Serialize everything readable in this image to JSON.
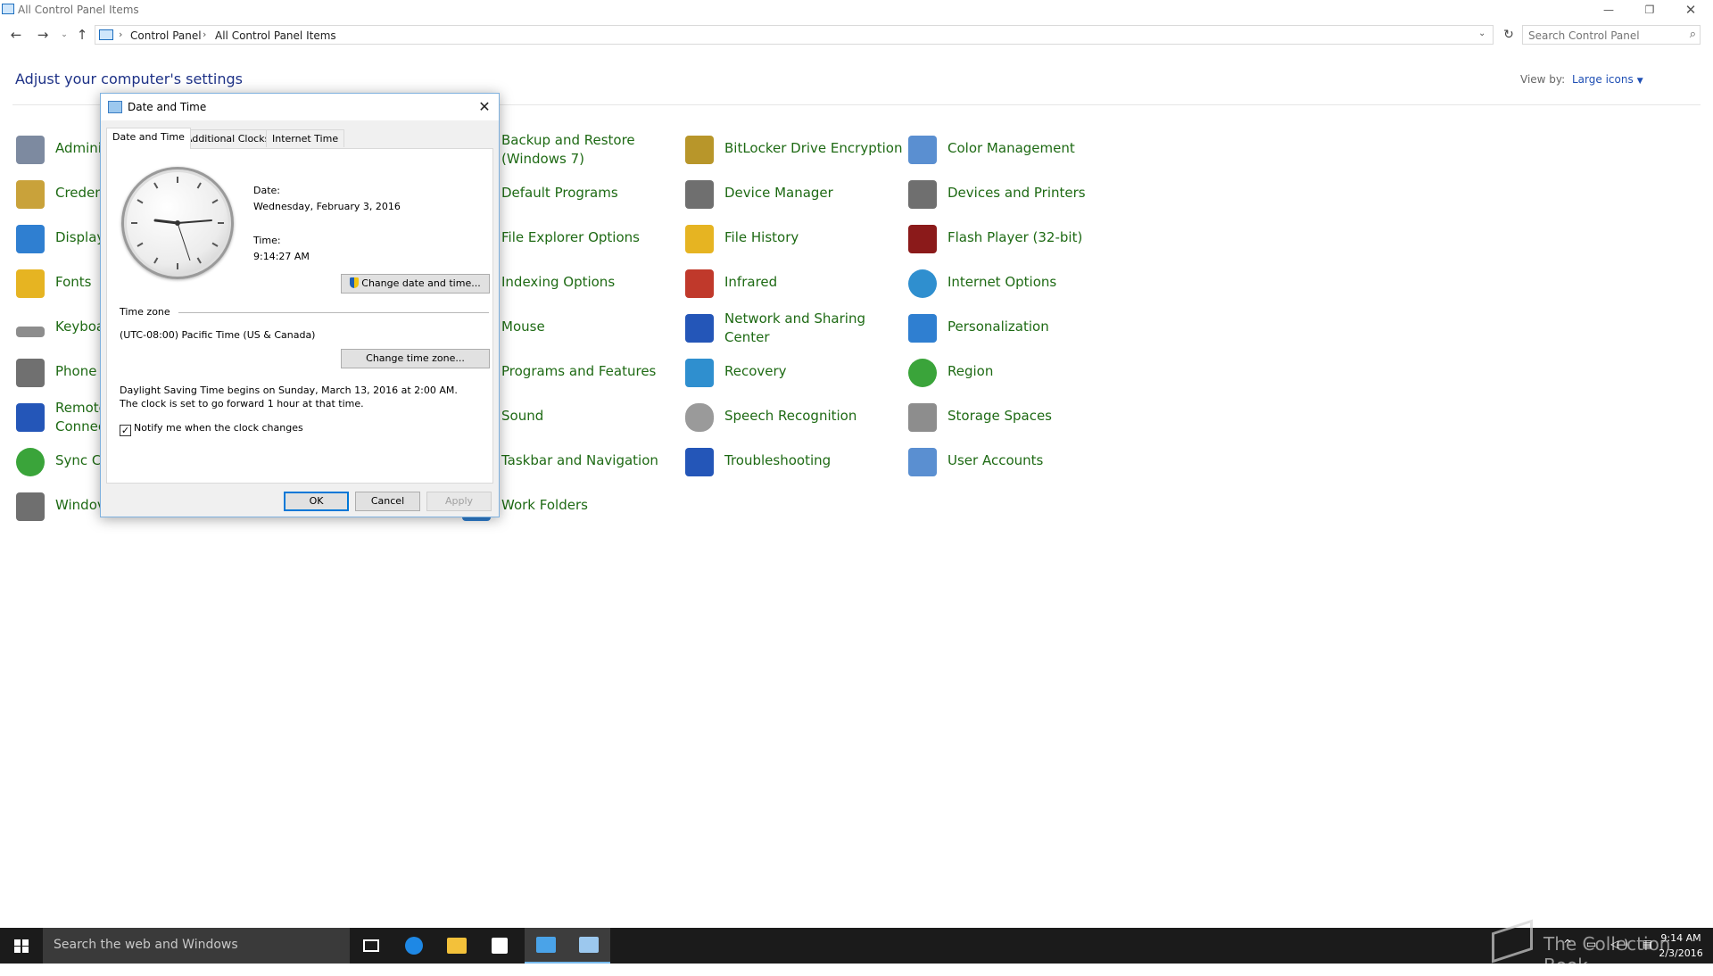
{
  "window": {
    "title": "All Control Panel Items",
    "minimize": "—",
    "maximize": "❐",
    "close": "✕"
  },
  "address": {
    "back": "←",
    "forward": "→",
    "recent": "⌄",
    "up": "↑",
    "separator": "›",
    "crumbs": [
      "Control Panel",
      "All Control Panel Items"
    ],
    "dropdown": "⌄",
    "refresh": "↻",
    "search_placeholder": "Search Control Panel",
    "search_icon": "⌕"
  },
  "header": {
    "title": "Adjust your computer's settings",
    "view_by_label": "View by:",
    "view_by_value": "Large icons",
    "view_by_caret": "▼"
  },
  "items": [
    {
      "label": "Admini",
      "icon": "administrative-tools-icon",
      "color": "#7d8aa0"
    },
    {
      "label": "Creden",
      "icon": "credential-manager-icon",
      "color": "#c9a23a"
    },
    {
      "label": "Display",
      "icon": "display-icon",
      "color": "#2f7fd1"
    },
    {
      "label": "Fonts",
      "icon": "fonts-icon",
      "color": "#e6b422"
    },
    {
      "label": "Keyboa",
      "icon": "keyboard-icon",
      "color": "#8d8d8d"
    },
    {
      "label": "Phone",
      "icon": "phone-icon",
      "color": "#707070"
    },
    {
      "label": "Remote\nConnec",
      "icon": "remote-app-icon",
      "color": "#2456b8"
    },
    {
      "label": "Sync C",
      "icon": "sync-center-icon",
      "color": "#3aa43a"
    },
    {
      "label": "Windov",
      "icon": "windows-firewall-icon",
      "color": "#6f6f6f"
    },
    {
      "label": "Backup and Restore (Windows 7)",
      "icon": "backup-restore-icon",
      "color": "#3f8f3f"
    },
    {
      "label": "Default Programs",
      "icon": "default-programs-icon",
      "color": "#2f7fd1"
    },
    {
      "label": "File Explorer Options",
      "icon": "file-explorer-options-icon",
      "color": "#e6b422"
    },
    {
      "label": "Indexing Options",
      "icon": "indexing-options-icon",
      "color": "#8aa0b8"
    },
    {
      "label": "Mouse",
      "icon": "mouse-icon",
      "color": "#9a9a9a"
    },
    {
      "label": "Programs and Features",
      "icon": "programs-features-icon",
      "color": "#7d7d7d"
    },
    {
      "label": "Sound",
      "icon": "sound-icon",
      "color": "#8d8d8d"
    },
    {
      "label": "Taskbar and Navigation",
      "icon": "taskbar-navigation-icon",
      "color": "#3e6fb5"
    },
    {
      "label": "Work Folders",
      "icon": "work-folders-icon",
      "color": "#2f7fd1"
    },
    {
      "label": "BitLocker Drive Encryption",
      "icon": "bitlocker-icon",
      "color": "#b8962a"
    },
    {
      "label": "Device Manager",
      "icon": "device-manager-icon",
      "color": "#6f6f6f"
    },
    {
      "label": "File History",
      "icon": "file-history-icon",
      "color": "#e6b422"
    },
    {
      "label": "Infrared",
      "icon": "infrared-icon",
      "color": "#c0392b"
    },
    {
      "label": "Network and Sharing Center",
      "icon": "network-sharing-icon",
      "color": "#2456b8"
    },
    {
      "label": "Recovery",
      "icon": "recovery-icon",
      "color": "#2f8fcf"
    },
    {
      "label": "Speech Recognition",
      "icon": "speech-recognition-icon",
      "color": "#9a9a9a"
    },
    {
      "label": "Troubleshooting",
      "icon": "troubleshooting-icon",
      "color": "#2456b8"
    },
    {
      "label": "Color Management",
      "icon": "color-management-icon",
      "color": "#5a8fd1"
    },
    {
      "label": "Devices and Printers",
      "icon": "devices-printers-icon",
      "color": "#6f6f6f"
    },
    {
      "label": "Flash Player (32-bit)",
      "icon": "flash-player-icon",
      "color": "#8b1a1a"
    },
    {
      "label": "Internet Options",
      "icon": "internet-options-icon",
      "color": "#2f8fcf"
    },
    {
      "label": "Personalization",
      "icon": "personalization-icon",
      "color": "#2f7fd1"
    },
    {
      "label": "Region",
      "icon": "region-icon",
      "color": "#3aa43a"
    },
    {
      "label": "Storage Spaces",
      "icon": "storage-spaces-icon",
      "color": "#8d8d8d"
    },
    {
      "label": "User Accounts",
      "icon": "user-accounts-icon",
      "color": "#5a8fd1"
    }
  ],
  "dialog": {
    "title": "Date and Time",
    "close": "✕",
    "tabs": [
      "Date and Time",
      "Additional Clocks",
      "Internet Time"
    ],
    "date_label": "Date:",
    "date_value": "Wednesday, February 3, 2016",
    "time_label": "Time:",
    "time_value": "9:14:27 AM",
    "change_datetime": "Change date and time...",
    "timezone_header": "Time zone",
    "timezone_value": "(UTC-08:00) Pacific Time (US & Canada)",
    "change_timezone": "Change time zone...",
    "dst_text": "Daylight Saving Time begins on Sunday, March 13, 2016 at 2:00 AM. The clock is set to go forward 1 hour at that time.",
    "notify_label": "Notify me when the clock changes",
    "notify_check": "✓",
    "ok": "OK",
    "cancel": "Cancel",
    "apply": "Apply"
  },
  "taskbar": {
    "search_placeholder": "Search the web and Windows",
    "tray_icons": "^ ▭ ◁) ▤",
    "time": "9:14 AM",
    "date": "2/3/2016",
    "watermark": "The Collection Book"
  }
}
